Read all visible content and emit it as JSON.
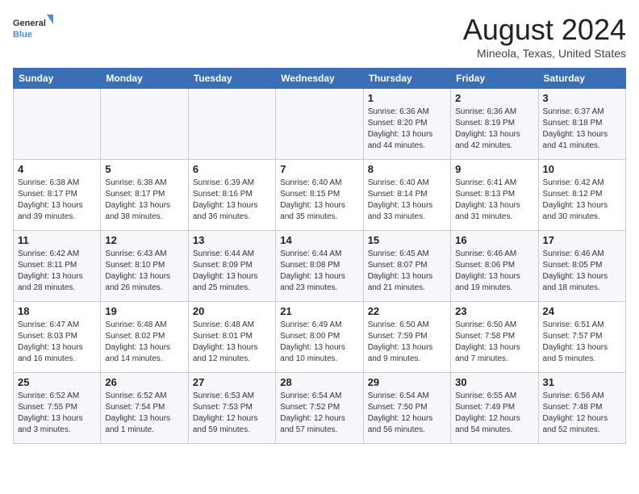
{
  "header": {
    "logo_general": "General",
    "logo_blue": "Blue",
    "month_year": "August 2024",
    "location": "Mineola, Texas, United States"
  },
  "days_of_week": [
    "Sunday",
    "Monday",
    "Tuesday",
    "Wednesday",
    "Thursday",
    "Friday",
    "Saturday"
  ],
  "weeks": [
    [
      {
        "day": "",
        "info": ""
      },
      {
        "day": "",
        "info": ""
      },
      {
        "day": "",
        "info": ""
      },
      {
        "day": "",
        "info": ""
      },
      {
        "day": "1",
        "info": "Sunrise: 6:36 AM\nSunset: 8:20 PM\nDaylight: 13 hours\nand 44 minutes."
      },
      {
        "day": "2",
        "info": "Sunrise: 6:36 AM\nSunset: 8:19 PM\nDaylight: 13 hours\nand 42 minutes."
      },
      {
        "day": "3",
        "info": "Sunrise: 6:37 AM\nSunset: 8:18 PM\nDaylight: 13 hours\nand 41 minutes."
      }
    ],
    [
      {
        "day": "4",
        "info": "Sunrise: 6:38 AM\nSunset: 8:17 PM\nDaylight: 13 hours\nand 39 minutes."
      },
      {
        "day": "5",
        "info": "Sunrise: 6:38 AM\nSunset: 8:17 PM\nDaylight: 13 hours\nand 38 minutes."
      },
      {
        "day": "6",
        "info": "Sunrise: 6:39 AM\nSunset: 8:16 PM\nDaylight: 13 hours\nand 36 minutes."
      },
      {
        "day": "7",
        "info": "Sunrise: 6:40 AM\nSunset: 8:15 PM\nDaylight: 13 hours\nand 35 minutes."
      },
      {
        "day": "8",
        "info": "Sunrise: 6:40 AM\nSunset: 8:14 PM\nDaylight: 13 hours\nand 33 minutes."
      },
      {
        "day": "9",
        "info": "Sunrise: 6:41 AM\nSunset: 8:13 PM\nDaylight: 13 hours\nand 31 minutes."
      },
      {
        "day": "10",
        "info": "Sunrise: 6:42 AM\nSunset: 8:12 PM\nDaylight: 13 hours\nand 30 minutes."
      }
    ],
    [
      {
        "day": "11",
        "info": "Sunrise: 6:42 AM\nSunset: 8:11 PM\nDaylight: 13 hours\nand 28 minutes."
      },
      {
        "day": "12",
        "info": "Sunrise: 6:43 AM\nSunset: 8:10 PM\nDaylight: 13 hours\nand 26 minutes."
      },
      {
        "day": "13",
        "info": "Sunrise: 6:44 AM\nSunset: 8:09 PM\nDaylight: 13 hours\nand 25 minutes."
      },
      {
        "day": "14",
        "info": "Sunrise: 6:44 AM\nSunset: 8:08 PM\nDaylight: 13 hours\nand 23 minutes."
      },
      {
        "day": "15",
        "info": "Sunrise: 6:45 AM\nSunset: 8:07 PM\nDaylight: 13 hours\nand 21 minutes."
      },
      {
        "day": "16",
        "info": "Sunrise: 6:46 AM\nSunset: 8:06 PM\nDaylight: 13 hours\nand 19 minutes."
      },
      {
        "day": "17",
        "info": "Sunrise: 6:46 AM\nSunset: 8:05 PM\nDaylight: 13 hours\nand 18 minutes."
      }
    ],
    [
      {
        "day": "18",
        "info": "Sunrise: 6:47 AM\nSunset: 8:03 PM\nDaylight: 13 hours\nand 16 minutes."
      },
      {
        "day": "19",
        "info": "Sunrise: 6:48 AM\nSunset: 8:02 PM\nDaylight: 13 hours\nand 14 minutes."
      },
      {
        "day": "20",
        "info": "Sunrise: 6:48 AM\nSunset: 8:01 PM\nDaylight: 13 hours\nand 12 minutes."
      },
      {
        "day": "21",
        "info": "Sunrise: 6:49 AM\nSunset: 8:00 PM\nDaylight: 13 hours\nand 10 minutes."
      },
      {
        "day": "22",
        "info": "Sunrise: 6:50 AM\nSunset: 7:59 PM\nDaylight: 13 hours\nand 9 minutes."
      },
      {
        "day": "23",
        "info": "Sunrise: 6:50 AM\nSunset: 7:58 PM\nDaylight: 13 hours\nand 7 minutes."
      },
      {
        "day": "24",
        "info": "Sunrise: 6:51 AM\nSunset: 7:57 PM\nDaylight: 13 hours\nand 5 minutes."
      }
    ],
    [
      {
        "day": "25",
        "info": "Sunrise: 6:52 AM\nSunset: 7:55 PM\nDaylight: 13 hours\nand 3 minutes."
      },
      {
        "day": "26",
        "info": "Sunrise: 6:52 AM\nSunset: 7:54 PM\nDaylight: 13 hours\nand 1 minute."
      },
      {
        "day": "27",
        "info": "Sunrise: 6:53 AM\nSunset: 7:53 PM\nDaylight: 12 hours\nand 59 minutes."
      },
      {
        "day": "28",
        "info": "Sunrise: 6:54 AM\nSunset: 7:52 PM\nDaylight: 12 hours\nand 57 minutes."
      },
      {
        "day": "29",
        "info": "Sunrise: 6:54 AM\nSunset: 7:50 PM\nDaylight: 12 hours\nand 56 minutes."
      },
      {
        "day": "30",
        "info": "Sunrise: 6:55 AM\nSunset: 7:49 PM\nDaylight: 12 hours\nand 54 minutes."
      },
      {
        "day": "31",
        "info": "Sunrise: 6:56 AM\nSunset: 7:48 PM\nDaylight: 12 hours\nand 52 minutes."
      }
    ]
  ]
}
